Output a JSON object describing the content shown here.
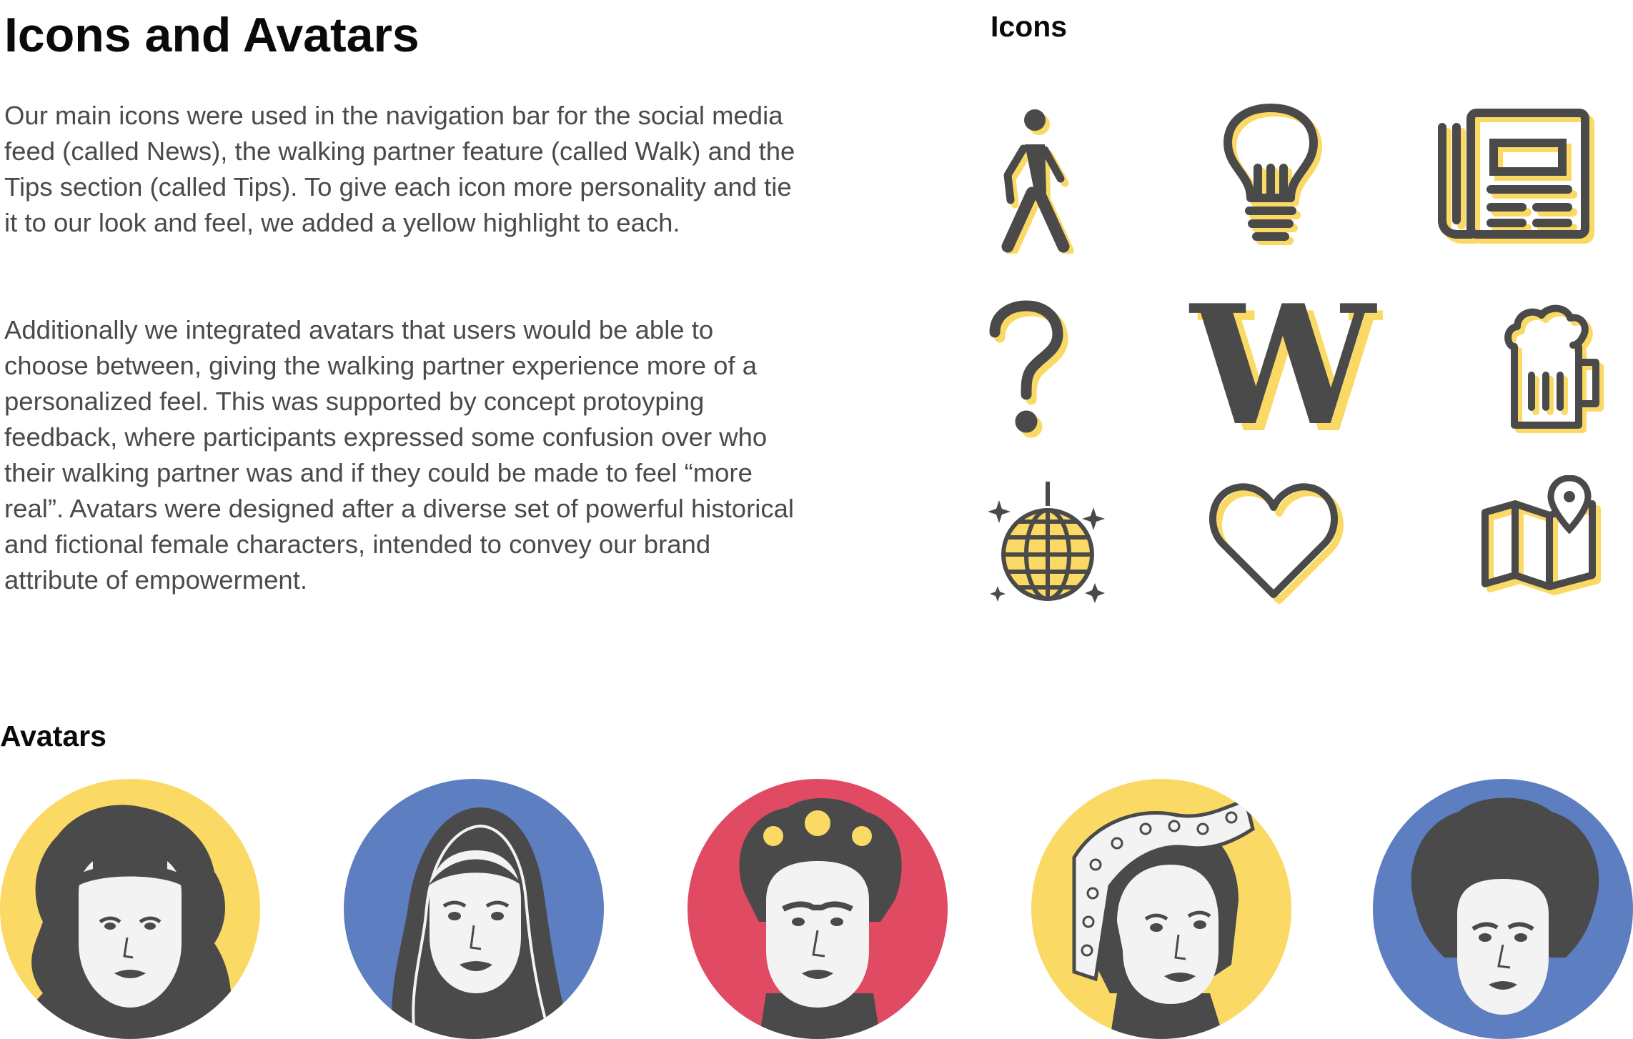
{
  "title": "Icons and Avatars",
  "paragraphs": [
    "Our main icons were used in the navigation bar for the social media feed (called News), the walking partner feature (called Walk) and the Tips section (called Tips). To give each icon more personality and tie it to our look and feel, we added a yellow highlight to each.",
    "Additionally we integrated avatars that users would be able to choose between, giving the walking partner experience more of a personalized feel. This was supported by concept protoyping feedback, where participants expressed some confusion over who their walking partner was and if they could be made to feel “more real”. Avatars were designed after a diverse set of powerful historical and fictional female characters, intended to convey our brand attribute of empowerment."
  ],
  "icons_section": {
    "heading": "Icons",
    "icons": [
      "walking-person-icon",
      "lightbulb-icon",
      "newspaper-icon",
      "question-mark-icon",
      "w-letter-icon",
      "beer-mug-icon",
      "disco-ball-icon",
      "heart-icon",
      "map-pin-icon"
    ],
    "w_letter": "W",
    "question_glyph": "?"
  },
  "avatars_section": {
    "heading": "Avatars",
    "avatars": [
      {
        "name": "avatar-wavy-hair-headband",
        "bg": "#fad964"
      },
      {
        "name": "avatar-headscarf",
        "bg": "#5d7ec1"
      },
      {
        "name": "avatar-flower-crown",
        "bg": "#e04a62"
      },
      {
        "name": "avatar-polka-dot-bandana",
        "bg": "#fad964"
      },
      {
        "name": "avatar-afro",
        "bg": "#5d7ec1"
      }
    ]
  },
  "colors": {
    "icon_dark": "#4a4a4a",
    "highlight_yellow": "#fad964",
    "skin": "#f3f3f3"
  }
}
